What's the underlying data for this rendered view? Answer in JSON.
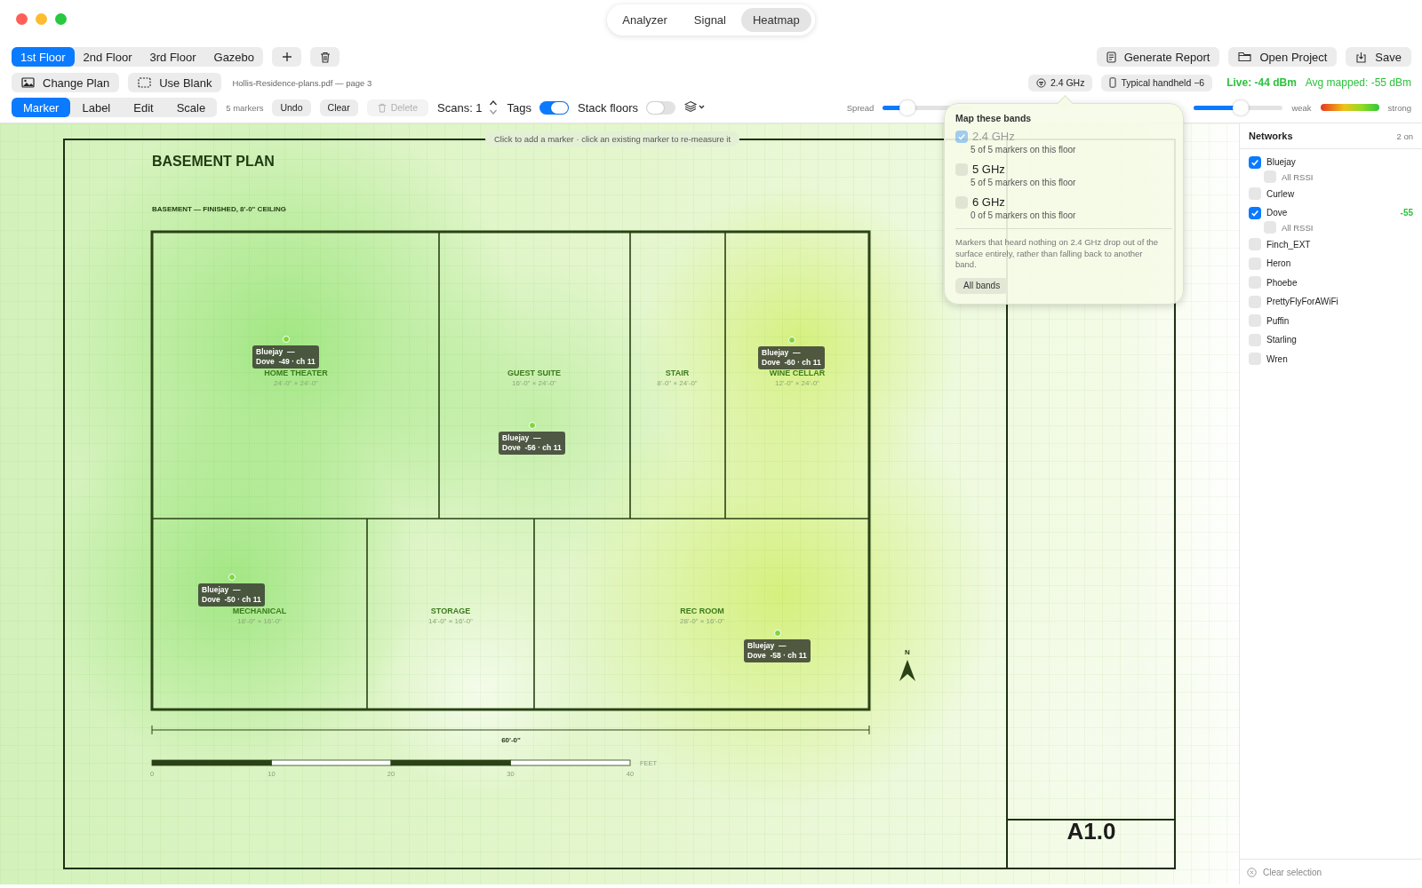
{
  "window": {
    "tabs": [
      {
        "label": "Analyzer",
        "selected": false
      },
      {
        "label": "Signal",
        "selected": false
      },
      {
        "label": "Heatmap",
        "selected": true
      }
    ]
  },
  "floors": [
    {
      "label": "1st Floor",
      "selected": true
    },
    {
      "label": "2nd Floor",
      "selected": false
    },
    {
      "label": "3rd Floor",
      "selected": false
    },
    {
      "label": "Gazebo",
      "selected": false
    }
  ],
  "project_buttons": [
    {
      "label": "Generate Report",
      "kind": "report"
    },
    {
      "label": "Open Project",
      "kind": "folder"
    },
    {
      "label": "Save",
      "kind": "save"
    }
  ],
  "plan_buttons": [
    {
      "label": "Change Plan",
      "kind": "image"
    },
    {
      "label": "Use Blank",
      "kind": "blank"
    }
  ],
  "plan_file": "Hollis-Residence-plans.pdf — page 3",
  "band_button": "2.4 GHz",
  "device_button": "Typical handheld −6",
  "live": "Live: -44 dBm",
  "avg_mapped": "Avg mapped: -55 dBm",
  "tools": [
    {
      "label": "Marker",
      "selected": true
    },
    {
      "label": "Label",
      "selected": false
    },
    {
      "label": "Edit",
      "selected": false
    },
    {
      "label": "Scale",
      "selected": false
    }
  ],
  "marker_count": "5 markers",
  "actions": [
    {
      "label": "Undo",
      "disabled": false
    },
    {
      "label": "Clear",
      "disabled": false
    },
    {
      "label": "Delete",
      "disabled": true
    }
  ],
  "scans": "Scans: 1",
  "toggles": [
    {
      "label": "Tags",
      "on": true
    },
    {
      "label": "Stack floors",
      "on": false
    }
  ],
  "spread": {
    "label": "Spread",
    "level": 0.28
  },
  "slider_2": {
    "level": 0.53
  },
  "legend": {
    "weak": "weak",
    "strong": "strong"
  },
  "canvas": {
    "hint": "Click to add a marker · click an existing marker to re-measure it",
    "title": "BASEMENT PLAN",
    "subtitle": "BASEMENT — FINISHED, 8'-0\" CEILING",
    "rooms": [
      {
        "name": "HOME THEATER",
        "size": "24'-0\" × 24'-0\""
      },
      {
        "name": "GUEST SUITE",
        "size": "16'-0\" × 24'-0\""
      },
      {
        "name": "STAIR",
        "size": "8'-0\" × 24'-0\""
      },
      {
        "name": "WINE CELLAR",
        "size": "12'-0\" × 24'-0\""
      },
      {
        "name": "MECHANICAL",
        "size": "18'-0\" × 16'-0\""
      },
      {
        "name": "STORAGE",
        "size": "14'-0\" × 16'-0\""
      },
      {
        "name": "REC ROOM",
        "size": "28'-0\" × 16'-0\""
      }
    ],
    "markers": [
      {
        "lines": [
          "Bluejay  —",
          "Dove  -49 · ch 11"
        ]
      },
      {
        "lines": [
          "Bluejay  —",
          "Dove  -56 · ch 11"
        ]
      },
      {
        "lines": [
          "Bluejay  —",
          "Dove  -60 · ch 11"
        ]
      },
      {
        "lines": [
          "Bluejay  —",
          "Dove  -50 · ch 11"
        ]
      },
      {
        "lines": [
          "Bluejay  —",
          "Dove  -58 · ch 11"
        ]
      }
    ],
    "dimension": "60'-0\"",
    "scale_ticks": [
      "0",
      "10",
      "20",
      "30",
      "40"
    ],
    "scale_unit": "FEET",
    "north": "N",
    "sheet": "A1.0"
  },
  "band_popover": {
    "title": "Map these bands",
    "bands": [
      {
        "label": "2.4 GHz",
        "note": "5 of 5 markers on this floor",
        "checked": true,
        "disabled": true
      },
      {
        "label": "5 GHz",
        "note": "5 of 5 markers on this floor",
        "checked": false,
        "disabled": false
      },
      {
        "label": "6 GHz",
        "note": "0 of 5 markers on this floor",
        "checked": false,
        "disabled": false
      }
    ],
    "note": "Markers that heard nothing on 2.4 GHz drop out of the surface entirely, rather than falling back to another band.",
    "button": "All bands"
  },
  "networks": {
    "title": "Networks",
    "count": "2 on",
    "items": [
      {
        "name": "Bluejay",
        "checked": true,
        "children": [
          {
            "name": "All RSSI",
            "checked": false
          }
        ]
      },
      {
        "name": "Curlew",
        "checked": false
      },
      {
        "name": "Dove",
        "checked": true,
        "value": "-55",
        "children": [
          {
            "name": "All RSSI",
            "checked": false
          }
        ]
      },
      {
        "name": "Finch_EXT",
        "checked": false
      },
      {
        "name": "Heron",
        "checked": false
      },
      {
        "name": "Phoebe",
        "checked": false
      },
      {
        "name": "PrettyFlyForAWiFi",
        "checked": false
      },
      {
        "name": "Puffin",
        "checked": false
      },
      {
        "name": "Starling",
        "checked": false
      },
      {
        "name": "Wren",
        "checked": false
      }
    ],
    "footer": "Clear selection"
  }
}
